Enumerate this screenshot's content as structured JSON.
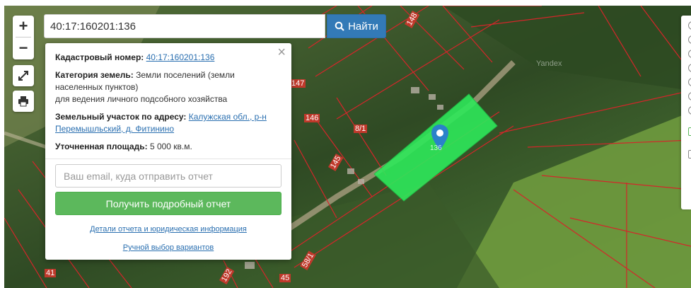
{
  "search": {
    "value": "40:17:160201:136",
    "button_label": "Найти",
    "icon": "search-icon"
  },
  "controls": {
    "zoom_in": "+",
    "zoom_out": "−",
    "fullscreen_icon": "fullscreen-icon",
    "print_icon": "printer-icon"
  },
  "popup": {
    "close": "×",
    "cadastral_label": "Кадастровый номер:",
    "cadastral_value": "40:17:160201:136",
    "category_label": "Категория земель:",
    "category_value_1": "Земли поселений (земли населенных пунктов)",
    "category_value_2": "для ведения личного подсобного хозяйства",
    "address_label": "Земельный участок по адресу:",
    "address_value": "Калужская обл., р-н Перемышльский, д. Фитинино",
    "area_label": "Уточненная площадь:",
    "area_value": "5 000 кв.м.",
    "email_placeholder": "Ваш email, куда отправить отчет",
    "report_button": "Получить подробный отчет",
    "details_link": "Детали отчета и юридическая информация",
    "manual_link": "Ручной выбор вариантов"
  },
  "map": {
    "parcel_labels": [
      "147",
      "146",
      "8/1",
      "145",
      "41",
      "192",
      "45",
      "58/1",
      "148"
    ],
    "marker_label": "136",
    "watermark": "Yandex",
    "colors": {
      "selected_parcel": "#2ee85a",
      "boundary": "#d4262a",
      "marker": "#2a82c9"
    }
  }
}
